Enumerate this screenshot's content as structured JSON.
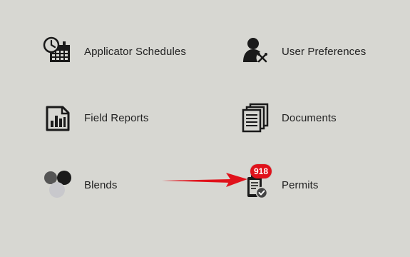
{
  "menu": {
    "items": [
      {
        "label": "Applicator Schedules",
        "icon": "calendar-clock-icon"
      },
      {
        "label": "User Preferences",
        "icon": "user-settings-icon"
      },
      {
        "label": "Field Reports",
        "icon": "report-chart-icon"
      },
      {
        "label": "Documents",
        "icon": "documents-icon"
      },
      {
        "label": "Blends",
        "icon": "blend-circles-icon"
      },
      {
        "label": "Permits",
        "icon": "permit-clipboard-icon",
        "badge": "918"
      }
    ]
  },
  "colors": {
    "background": "#d7d7d2",
    "badge": "#e0121b",
    "arrow": "#e0121b",
    "icon": "#1a1a1a"
  }
}
